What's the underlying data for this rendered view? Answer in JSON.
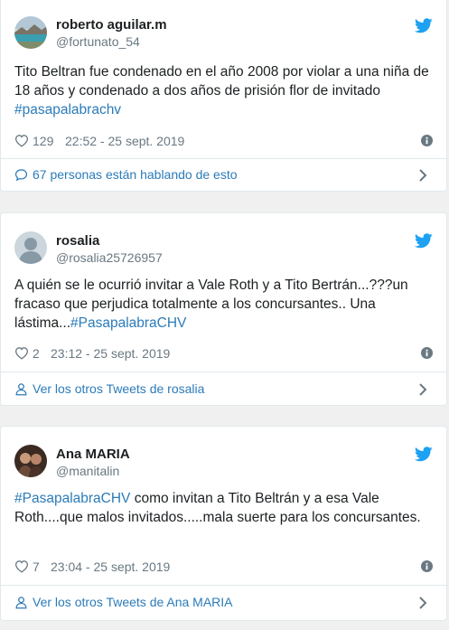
{
  "colors": {
    "link": "#2b7bb9",
    "muted": "#697882",
    "twitter_blue": "#1da1f2"
  },
  "tweets": [
    {
      "name": "roberto aguilar.m",
      "handle": "@fortunato_54",
      "text_plain": "Tito Beltran fue  condenado en el año 2008 por violar a una niña de 18 años y condenado a dos años de prisión flor de invitado ",
      "hashtag": "#pasapalabrachv",
      "likes": "129",
      "time": "22:52 - 25 sept. 2019",
      "footer": "67 personas están hablando de esto",
      "footer_icon": "comment-icon"
    },
    {
      "name": "rosalia",
      "handle": "@rosalia25726957",
      "text_plain": "A quién se le ocurrió invitar a Vale Roth y a Tito Bertrán...???un fracaso que perjudica totalmente a los concursantes.. Una lástima...",
      "hashtag": "#PasapalabraCHV",
      "likes": "2",
      "time": "23:12 - 25 sept. 2019",
      "footer": "Ver los otros Tweets de rosalia",
      "footer_icon": "person-icon"
    },
    {
      "name": "Ana MARIA",
      "handle": "@manitalin",
      "hashtag": "#PasapalabraCHV",
      "text_plain": " como invitan a Tito Beltrán  y a esa Vale Roth....que malos invitados.....mala suerte para los concursantes.",
      "likes": "7",
      "time": "23:04 - 25 sept. 2019",
      "footer": "Ver los otros Tweets de Ana MARIA",
      "footer_icon": "person-icon"
    }
  ]
}
